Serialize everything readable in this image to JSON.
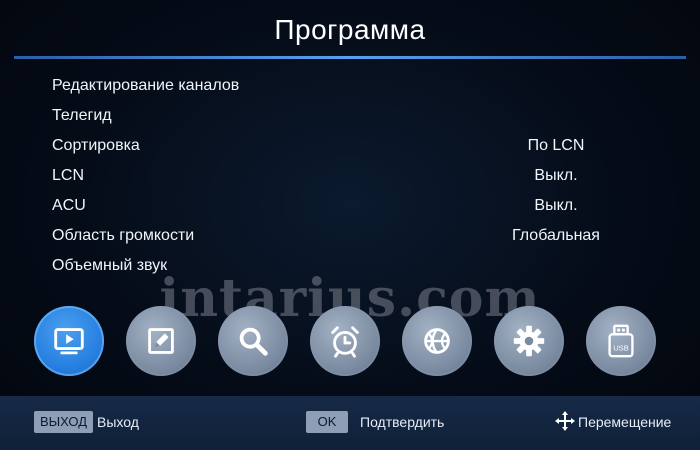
{
  "header": {
    "title": "Программа"
  },
  "menu": {
    "items": [
      {
        "label": "Редактирование каналов",
        "value": ""
      },
      {
        "label": "Телегид",
        "value": ""
      },
      {
        "label": "Сортировка",
        "value": "По LCN"
      },
      {
        "label": "LCN",
        "value": "Выкл."
      },
      {
        "label": "ACU",
        "value": "Выкл."
      },
      {
        "label": "Область громкости",
        "value": "Глобальная"
      },
      {
        "label": "Объемный звук",
        "value": ""
      }
    ]
  },
  "watermark": "intarius.com",
  "dock": {
    "icons": [
      "tv-icon",
      "edit-icon",
      "search-icon",
      "alarm-clock-icon",
      "ball-icon",
      "gear-icon",
      "usb-icon"
    ],
    "active_index": 0,
    "usb_text": "USB"
  },
  "footer": {
    "exit_key": "ВЫХОД",
    "exit_label": "Выход",
    "ok_key": "OK",
    "ok_label": "Подтвердить",
    "move_label": "Перемещение"
  },
  "colors": {
    "accent": "#2a86e6",
    "rule": "#4a8fe0",
    "footer_bg": "#132540"
  }
}
